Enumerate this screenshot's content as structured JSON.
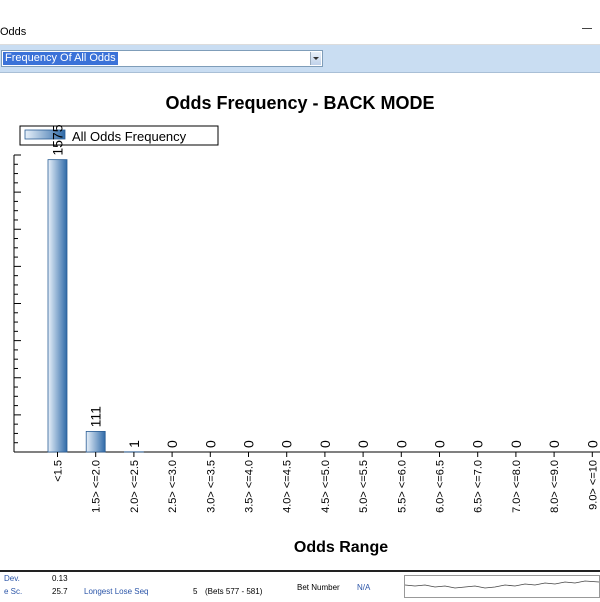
{
  "window": {
    "title": "Odds"
  },
  "toolbar": {
    "selected_view": "Frequency Of All Odds"
  },
  "chart_data": {
    "type": "bar",
    "title": "Odds Frequency - BACK MODE",
    "xlabel": "Odds Range",
    "legend": {
      "entries": [
        "All Odds Frequency"
      ],
      "placement": "top-left"
    },
    "categories": [
      "<1.5",
      "1.5> <=2.0",
      "2.0> <=2.5",
      "2.5> <=3.0",
      "3.0> <=3.5",
      "3.5> <=4.0",
      "4.0> <=4.5",
      "4.5> <=5.0",
      "5.0> <=5.5",
      "5.5> <=6.0",
      "6.0> <=6.5",
      "6.5> <=7.0",
      "7.0> <=8.0",
      "8.0> <=9.0",
      "9.0> <=10"
    ],
    "series": [
      {
        "name": "All Odds Frequency",
        "values": [
          1575,
          111,
          1,
          0,
          0,
          0,
          0,
          0,
          0,
          0,
          0,
          0,
          0,
          0,
          0
        ]
      }
    ],
    "ylim": [
      0,
      1600
    ],
    "colors": {
      "bar_light": "#e8f1fa",
      "bar_dark": "#2f6aa8",
      "bar_border": "#2a5d94"
    }
  },
  "footer": {
    "r1_label": "Dev.",
    "r1_value": "0.13",
    "r2_label": "e Sc.",
    "r2_value": "25.7",
    "longest_lose_label": "Longest Lose Seq",
    "longest_lose_value": "5",
    "longest_lose_bets": "(Bets 577 - 581)",
    "bet_number_label": "Bet Number",
    "bet_number_value": "N/A"
  }
}
